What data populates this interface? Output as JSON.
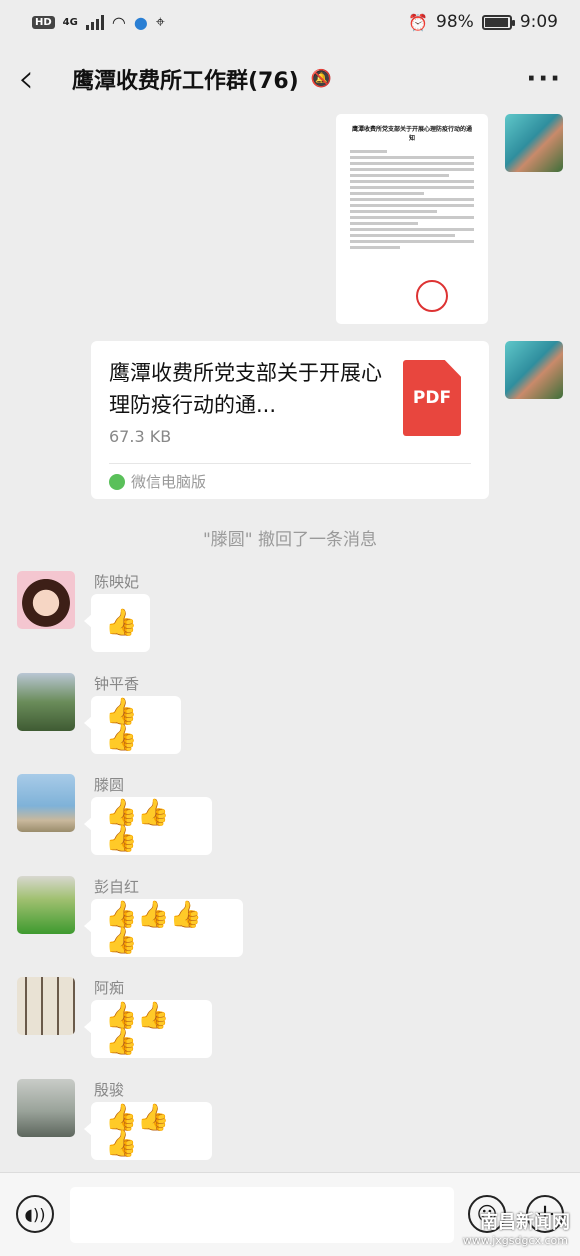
{
  "status_bar": {
    "hd_label": "HD",
    "network_label": "4G",
    "battery": "98%",
    "battery_level": 0.98,
    "time": "9:09"
  },
  "header": {
    "title": "鹰潭收费所工作群(76)"
  },
  "file_message": {
    "file_name": "鹰潭收费所党支部关于开展心理防疫行动的通...",
    "file_size": "67.3 KB",
    "file_type": "PDF",
    "source": "微信电脑版"
  },
  "document_preview": {
    "heading": "鹰潭收费所党支部关于开展心理防疫行动的通知"
  },
  "system_message": "\"滕圆\" 撤回了一条消息",
  "messages": [
    {
      "sender": "陈映妃",
      "thumbs": "👍"
    },
    {
      "sender": "钟平香",
      "thumbs": "👍👍"
    },
    {
      "sender": "滕圆",
      "thumbs": "👍👍👍"
    },
    {
      "sender": "彭自红",
      "thumbs": "👍👍👍👍"
    },
    {
      "sender": "阿痴",
      "thumbs": "👍👍👍"
    },
    {
      "sender": "殷骏",
      "thumbs": "👍👍👍"
    }
  ],
  "watermark": "南昌新闻网",
  "watermark_url": "www.jxgsdgcx.com"
}
